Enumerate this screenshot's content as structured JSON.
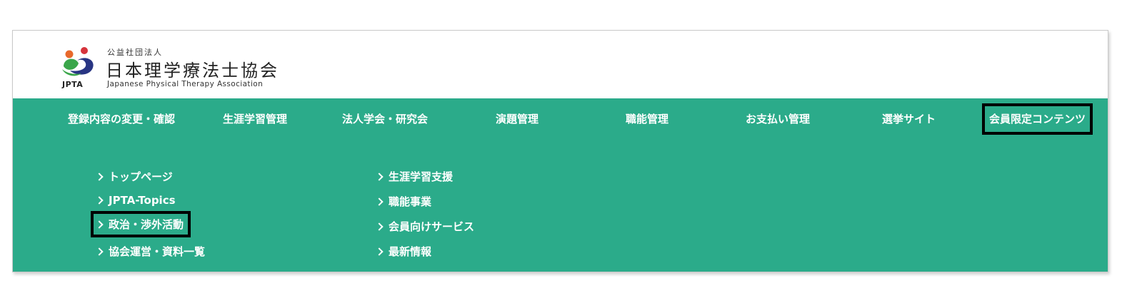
{
  "logo": {
    "subtitle": "公益社団法人",
    "name": "日本理学療法士協会",
    "english": "Japanese Physical Therapy Association",
    "abbr": "JPTA",
    "colors": {
      "orange": "#e8692b",
      "red": "#d6343c",
      "green": "#3aa64a",
      "navy": "#283583"
    }
  },
  "nav": {
    "bg_color": "#2bab8a",
    "items": [
      {
        "label": "登録内容の変更・確認"
      },
      {
        "label": "生涯学習管理"
      },
      {
        "label": "法人学会・研究会"
      },
      {
        "label": "演題管理"
      },
      {
        "label": "職能管理"
      },
      {
        "label": "お支払い管理"
      },
      {
        "label": "選挙サイト"
      },
      {
        "label": "会員限定コンテンツ"
      }
    ]
  },
  "submenu": {
    "left": [
      {
        "label": "トップページ"
      },
      {
        "label": "JPTA-Topics"
      },
      {
        "label": "政治・渉外活動"
      },
      {
        "label": "協会運営・資料一覧"
      }
    ],
    "right": [
      {
        "label": "生涯学習支援"
      },
      {
        "label": "職能事業"
      },
      {
        "label": "会員向けサービス"
      },
      {
        "label": "最新情報"
      }
    ]
  }
}
